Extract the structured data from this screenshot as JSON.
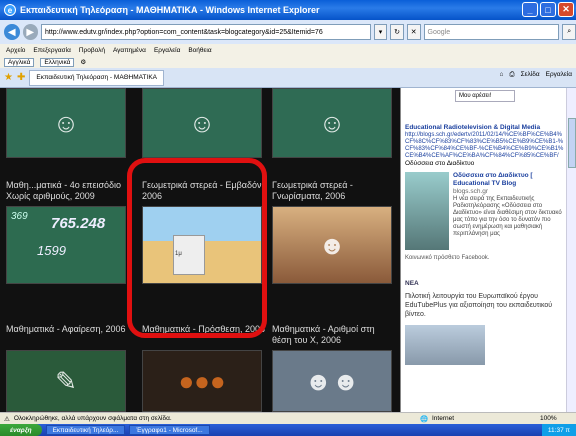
{
  "window": {
    "title": "Εκπαιδευτική Τηλεόραση - ΜΑΘΗΜΑΤΙΚΑ - Windows Internet Explorer"
  },
  "address": {
    "url": "http://www.edutv.gr/index.php?option=com_content&task=blogcategory&id=25&Itemid=76",
    "search_placeholder": "Google"
  },
  "menu": {
    "items": [
      "Αρχείο",
      "Επεξεργασία",
      "Προβολή",
      "Αγαπημένα",
      "Εργαλεία",
      "Βοήθεια"
    ]
  },
  "links_bar": {
    "search_engine": "Αγγλικά",
    "language": "Ελληνικά"
  },
  "tab": {
    "title": "Εκπαιδευτική Τηλεόραση - ΜΑΘΗΜΑΤΙΚΑ",
    "page_label": "Σελίδα",
    "tools_label": "Εργαλεία"
  },
  "videos": [
    {
      "title": "Μαθη...ματικά - 4ο επεισόδιο Χωρίς αριθμούς, 2009"
    },
    {
      "title": "Γεωμετρικά στερεά - Εμβαδόν, 2006"
    },
    {
      "title": "Γεωμετρικά στερεά - Γνωρίσματα, 2006"
    },
    {
      "title": "Μαθηματικά - Αφαίρεση, 2006"
    },
    {
      "title": "Μαθηματικά - Πρόσθεση, 2006"
    },
    {
      "title": "Μαθηματικά - Αριθμοί στη θέση του Χ, 2006"
    }
  ],
  "thumb_texts": {
    "numbers": "765.248",
    "number2": "1599",
    "number3": "369",
    "box_label": "1μ"
  },
  "sidebar": {
    "top_button": "Μου αρέσει!",
    "link_title": "Educational Radiotelevision & Digital Media",
    "link_url": "http://blogs.sch.gr/edertv/2011/02/14/%CE%BF%CE%B4%CF%8C%CF%83%CF%83%CE%B5%CE%B9%CE%B1-%CF%83%CF%84%CE%BF-%CE%B4%CE%B9%CE%B1%CE%B4%CE%AF%CE%BA%CF%84%CF%85%CE%BF/",
    "link_suffix": "Οδύσσεια στο Διαδίκτυο",
    "blog_title": "Οδύσσεια στο Διαδίκτυο [ Educational TV Blog",
    "blog_site": "blogs.sch.gr",
    "blog_text": "Η νέα σειρά της Εκπαιδευτικής Ραδιοτηλεόρασης «Οδύσσεια στο Διαδίκτυο» είναι διαθέσιμη στον δικτυακό μας τόπο για την όσο το δυνατόν πιο σωστή ενημέρωση και μαθησιακή περιπλάνηση μας",
    "facebook": "Κοινωνικό πρόσθετο Facebook.",
    "news_header": "ΝΕΑ",
    "news_text": "Πιλοτική λειτουργία του Ευρωπαϊκού έργου EduTubePlus για αξιοποίηση του εκπαιδευτικού βίντεο."
  },
  "status": {
    "message": "Ολοκληρώθηκε, αλλά υπάρχουν σφάλματα στη σελίδα.",
    "zone": "Internet",
    "zoom": "100%"
  },
  "taskbar": {
    "start": "έναρξη",
    "items": [
      "Εκπαιδευτική Τηλεόρ...",
      "Έγγραφο1 - Microsof..."
    ],
    "clock": "11:37 π"
  }
}
